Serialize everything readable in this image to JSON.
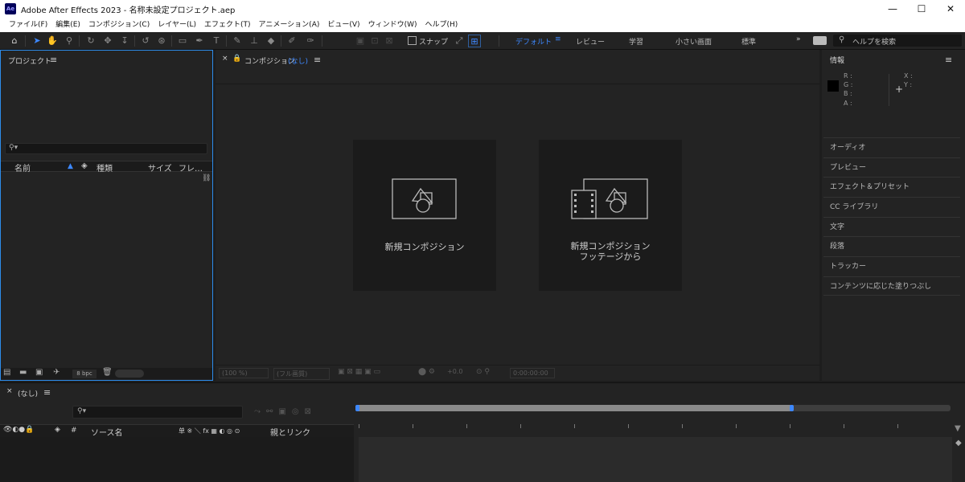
{
  "title_bar": {
    "app_icon_label": "Ae",
    "title": "Adobe After Effects 2023 - 名称未設定プロジェクト.aep",
    "minimize": "—",
    "maximize": "☐",
    "close": "✕"
  },
  "menu": [
    "ファイル(F)",
    "編集(E)",
    "コンポジション(C)",
    "レイヤー(L)",
    "エフェクト(T)",
    "アニメーション(A)",
    "ビュー(V)",
    "ウィンドウ(W)",
    "ヘルプ(H)"
  ],
  "toolbar": {
    "snap_label": "スナップ",
    "workspaces": [
      "デフォルト",
      "レビュー",
      "学習",
      "小さい画面",
      "標準"
    ],
    "active_workspace": "デフォルト",
    "more": "»",
    "search_placeholder": "ヘルプを検索"
  },
  "project_panel": {
    "title": "プロジェクト",
    "menu_icon": "≡",
    "columns": [
      "名前",
      "種類",
      "サイズ",
      "フレ…"
    ],
    "bpc": "8 bpc"
  },
  "composition_panel": {
    "close": "×",
    "title_prefix": "コンポジション",
    "title_value": "(なし)",
    "menu_icon": "≡",
    "new_comp": "新規コンポジション",
    "new_comp_from_footage_line1": "新規コンポジション",
    "new_comp_from_footage_line2": "フッテージから",
    "viewer_bar": {
      "zoom": "(100 %)",
      "resolution": "(フル画質)",
      "exposure": "+0.0",
      "timecode": "0:00:00:00"
    }
  },
  "info_panel": {
    "title": "情報",
    "menu_icon": "≡",
    "r": "R :",
    "g": "G :",
    "b": "B :",
    "a": "A :",
    "x": "X :",
    "y": "Y :",
    "swatch_color": "#000000",
    "items": [
      "オーディオ",
      "プレビュー",
      "エフェクト＆プリセット",
      "CC ライブラリ",
      "文字",
      "段落",
      "トラッカー",
      "コンテンツに応じた塗りつぶし"
    ]
  },
  "timeline": {
    "close": "×",
    "title": "(なし)",
    "menu_icon": "≡",
    "col_hash": "#",
    "col_source": "ソース名",
    "col_parent": "親とリンク",
    "switches": "单 ※ ＼ fx ▦ ◐ ◎ ⊙",
    "work_area_fraction": 0.734
  },
  "colors": {
    "accent": "#3d88ff",
    "panel": "#232323",
    "border_active": "#2d8ceb"
  }
}
